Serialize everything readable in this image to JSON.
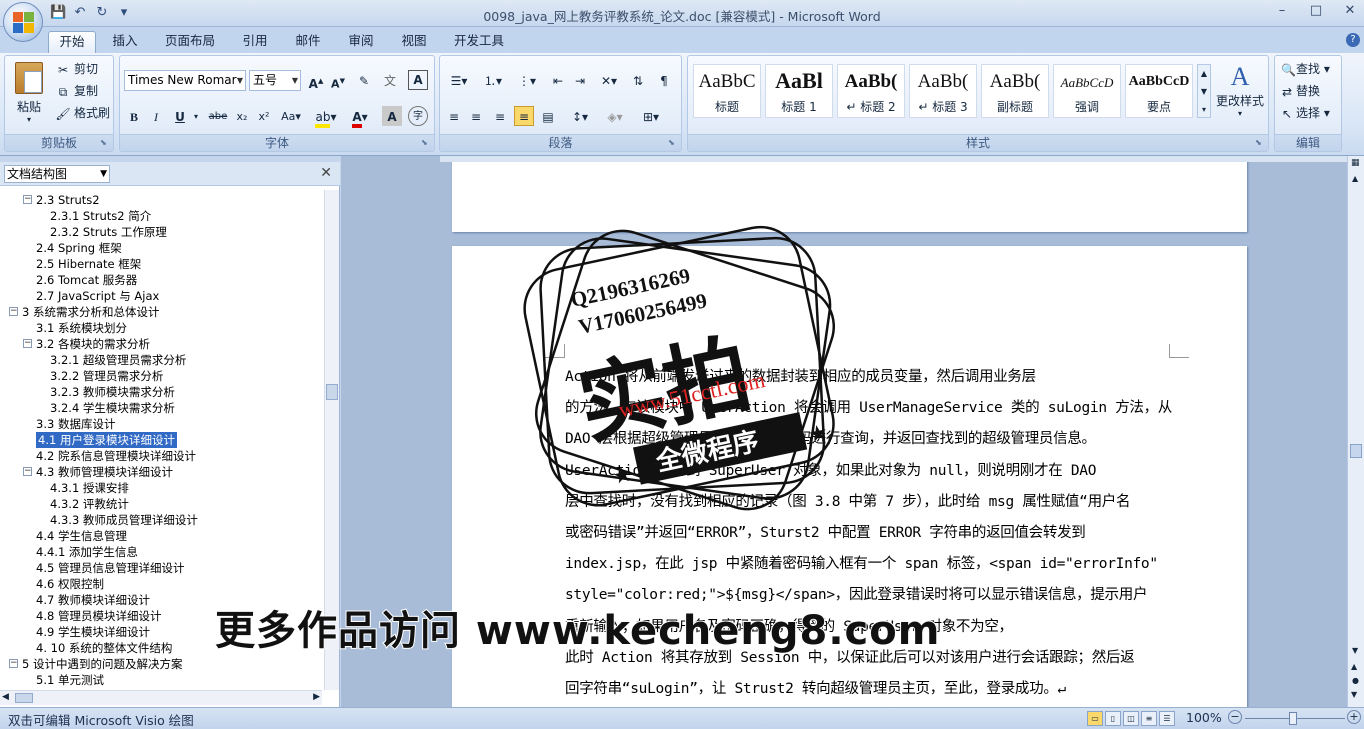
{
  "window": {
    "title": "0098_java_网上教务评教系统_论文.doc [兼容模式] - Microsoft Word",
    "controls": [
      "–",
      "□",
      "✕"
    ]
  },
  "quick_access": [
    "save-icon",
    "undo-icon",
    "redo-icon",
    "customize-icon"
  ],
  "tabs": [
    {
      "label": "开始",
      "active": true
    },
    {
      "label": "插入"
    },
    {
      "label": "页面布局"
    },
    {
      "label": "引用"
    },
    {
      "label": "邮件"
    },
    {
      "label": "审阅"
    },
    {
      "label": "视图"
    },
    {
      "label": "开发工具"
    }
  ],
  "ribbon": {
    "clipboard": {
      "paste": "粘贴",
      "cut": "剪切",
      "copy": "复制",
      "format_painter": "格式刷",
      "label": "剪贴板"
    },
    "font": {
      "font_name": "Times New Romar",
      "font_size": "五号",
      "label": "字体"
    },
    "paragraph": {
      "label": "段落"
    },
    "styles": {
      "label": "样式",
      "change_styles": "更改样式",
      "items": [
        {
          "sample": "AaBbC",
          "name": "标题"
        },
        {
          "sample": "AaBl",
          "name": "标题 1"
        },
        {
          "sample": "AaBb(",
          "name": "↵ 标题 2"
        },
        {
          "sample": "AaBb(",
          "name": "↵ 标题 3"
        },
        {
          "sample": "AaBb(",
          "name": "副标题"
        },
        {
          "sample": "AaBbCcD",
          "name": "强调"
        },
        {
          "sample": "AaBbCcD",
          "name": "要点"
        }
      ]
    },
    "editing": {
      "find": "查找",
      "replace": "替换",
      "select": "选择",
      "label": "编辑"
    }
  },
  "nav": {
    "mode": "文档结构图",
    "items": [
      {
        "text": "2.3 Struts2",
        "level": 2,
        "toggle": "-"
      },
      {
        "text": "2.3.1 Struts2 简介",
        "level": 3
      },
      {
        "text": "2.3.2 Struts 工作原理",
        "level": 3
      },
      {
        "text": "2.4 Spring 框架",
        "level": 2
      },
      {
        "text": "2.5 Hibernate 框架",
        "level": 2
      },
      {
        "text": "2.6 Tomcat 服务器",
        "level": 2
      },
      {
        "text": "2.7 JavaScript 与 Ajax",
        "level": 2
      },
      {
        "text": "3 系统需求分析和总体设计",
        "level": 1,
        "toggle": "-"
      },
      {
        "text": "3.1 系统模块划分",
        "level": 2
      },
      {
        "text": "3.2 各模块的需求分析",
        "level": 2,
        "toggle": "-"
      },
      {
        "text": "3.2.1 超级管理员需求分析",
        "level": 3
      },
      {
        "text": "3.2.2 管理员需求分析",
        "level": 3
      },
      {
        "text": "3.2.3 教师模块需求分析",
        "level": 3
      },
      {
        "text": "3.2.4 学生模块需求分析",
        "level": 3
      },
      {
        "text": "3.3 数据库设计",
        "level": 2
      },
      {
        "text": "4.1 用户登录模块详细设计",
        "level": 2,
        "selected": true
      },
      {
        "text": "4.2 院系信息管理模块详细设计",
        "level": 2
      },
      {
        "text": "4.3 教师管理模块详细设计",
        "level": 2,
        "toggle": "-"
      },
      {
        "text": "4.3.1 授课安排",
        "level": 3
      },
      {
        "text": "4.3.2 评教统计",
        "level": 3
      },
      {
        "text": "4.3.3 教师成员管理详细设计",
        "level": 3
      },
      {
        "text": "4.4 学生信息管理",
        "level": 2
      },
      {
        "text": "4.4.1 添加学生信息",
        "level": 2
      },
      {
        "text": "4.5 管理员信息管理详细设计",
        "level": 2
      },
      {
        "text": "4.6 权限控制",
        "level": 2
      },
      {
        "text": "4.7 教师模块详细设计",
        "level": 2
      },
      {
        "text": "4.8 管理员模块详细设计",
        "level": 2
      },
      {
        "text": "4.9 学生模块详细设计",
        "level": 2
      },
      {
        "text": "4. 10 系统的整体文件结构",
        "level": 2
      },
      {
        "text": "5 设计中遇到的问题及解决方案",
        "level": 1,
        "toggle": "-"
      },
      {
        "text": "5.1 单元测试",
        "level": 2
      }
    ]
  },
  "document": {
    "lines": [
      "Action 将从前端发送过来的数据封装到相应的成员变量，然后调用业务层",
      "的方法，在该模块中 UserAction 将会调用 UserManageService 类的 suLogin 方法，从",
      "DAO 层根据超级管理员的用户名及密码进行查询，并返回查找到的超级管理员信息。",
      "UserAction 会得到 SuperUser 对象，如果此对象为 null，则说明刚才在 DAO",
      "层中查找时，没有找到相应的记录（图 3.8 中第 7 步），此时给 msg 属性赋值“用户名",
      "或密码错误”并返回“ERROR”，Sturst2 中配置 ERROR 字符串的返回值会转发到",
      "index.jsp，在此 jsp 中紧随着密码输入框有一个 span 标签，<span id=\"errorInfo\"",
      "style=\"color:red;\">${msg}</span>，因此登录错误时将可以显示错误信息，提示用户",
      "重新输入；如果用户名及密码正确，得到的 SuperUser 对象不为空，",
      "此时 Action 将其存放到 Session 中，以保证此后可以对该用户进行会话跟踪；然后返",
      "回字符串“suLogin”，让 Strust2 转向超级管理员主页，至此，登录成功。↵"
    ]
  },
  "status": {
    "message": "双击可编辑 Microsoft Visio 绘图",
    "zoom": "100%"
  },
  "overlays": {
    "stamp_line1": "Q2196316269",
    "stamp_line2": "V17060256499",
    "stamp_main": "实拍",
    "stamp_url": "www.51cctl.com",
    "stamp_ribbon": "全微程序",
    "banner": "更多作品访问 www.kecheng8.com"
  }
}
